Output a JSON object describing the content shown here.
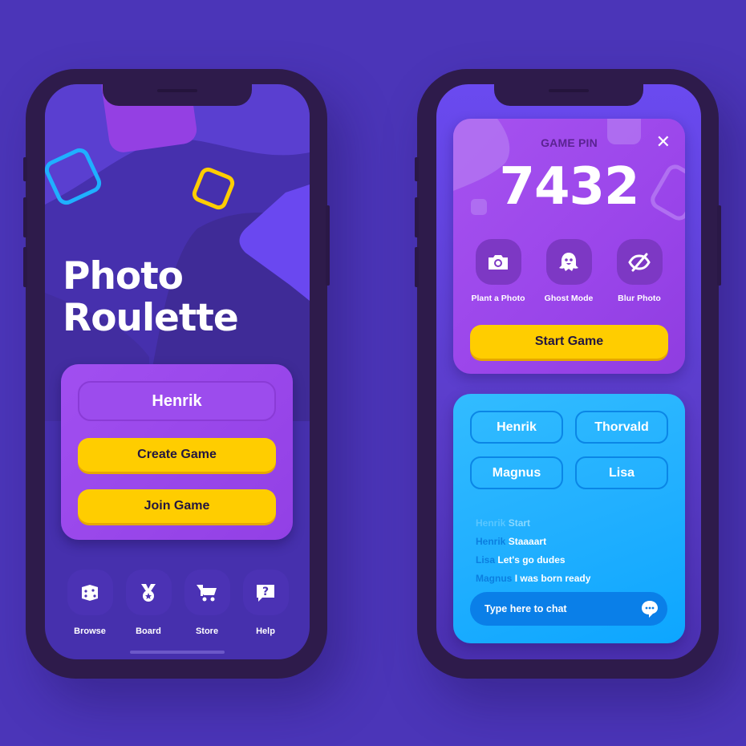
{
  "left_phone": {
    "title_line1": "Photo",
    "title_line2": "Roulette",
    "name_field": {
      "value": "Henrik"
    },
    "create_game_label": "Create Game",
    "join_game_label": "Join Game",
    "nav": [
      {
        "label": "Browse",
        "icon": "dice-icon"
      },
      {
        "label": "Board",
        "icon": "medal-icon"
      },
      {
        "label": "Store",
        "icon": "cart-icon"
      },
      {
        "label": "Help",
        "icon": "help-icon"
      }
    ]
  },
  "right_phone": {
    "pin_label": "GAME PIN",
    "pin_value": "7432",
    "close_icon": "✕",
    "options": [
      {
        "label": "Plant a Photo",
        "icon": "camera-icon"
      },
      {
        "label": "Ghost Mode",
        "icon": "ghost-icon"
      },
      {
        "label": "Blur Photo",
        "icon": "eye-off-icon"
      }
    ],
    "start_game_label": "Start Game",
    "players": [
      "Henrik",
      "Thorvald",
      "Magnus",
      "Lisa"
    ],
    "chat": [
      {
        "name": "Henrik",
        "message": "Start",
        "faded": true
      },
      {
        "name": "Henrik",
        "message": "Staaaart",
        "faded": false
      },
      {
        "name": "Lisa",
        "message": "Let's go dudes",
        "faded": false
      },
      {
        "name": "Magnus",
        "message": "I was born ready",
        "faded": false
      }
    ],
    "chat_placeholder": "Type here to chat"
  },
  "colors": {
    "background": "#4b35b8",
    "accent_yellow": "#ffcd00",
    "card_purple": "#a14ff0",
    "card_blue": "#22b0ff",
    "chat_name_blue": "#0b7fe0"
  }
}
